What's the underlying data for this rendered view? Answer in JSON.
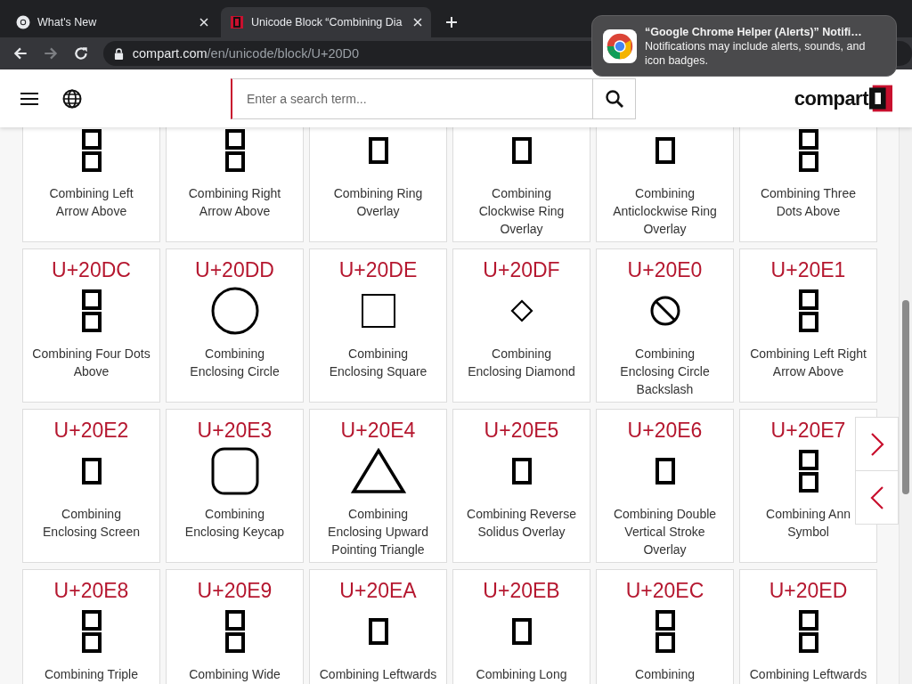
{
  "browser": {
    "tabs": [
      {
        "title": "What's New",
        "selected": false,
        "kind": "chrome"
      },
      {
        "title": "Unicode Block “Combining Dia",
        "selected": true,
        "kind": "site"
      }
    ],
    "url_host": "compart.com",
    "url_path": "/en/unicode/block/U+20D0"
  },
  "notification": {
    "title": "“Google Chrome Helper (Alerts)” Notifi…",
    "body": "Notifications may include alerts, sounds, and icon badges."
  },
  "site_header": {
    "search": {
      "placeholder": "Enter a search term..."
    },
    "logo": "compart"
  },
  "characters": [
    {
      "kind": "tofu-double",
      "name": "Combining Left\nArrow Above"
    },
    {
      "kind": "tofu-double",
      "name": "Combining Right\nArrow Above"
    },
    {
      "kind": "tofu",
      "name": "Combining Ring\nOverlay"
    },
    {
      "kind": "tofu",
      "name": "Combining\nClockwise Ring\nOverlay"
    },
    {
      "kind": "tofu",
      "name": "Combining\nAnticlockwise Ring\nOverlay"
    },
    {
      "kind": "tofu-double",
      "name": "Combining Three\nDots Above"
    },
    {
      "code": "U+20DC",
      "kind": "tofu-double",
      "name": "Combining Four Dots\nAbove"
    },
    {
      "code": "U+20DD",
      "kind": "circle",
      "name": "Combining\nEnclosing Circle"
    },
    {
      "code": "U+20DE",
      "kind": "square",
      "name": "Combining\nEnclosing Square"
    },
    {
      "code": "U+20DF",
      "kind": "diamond",
      "name": "Combining\nEnclosing Diamond"
    },
    {
      "code": "U+20E0",
      "kind": "circle-slash",
      "name": "Combining\nEnclosing Circle\nBackslash"
    },
    {
      "code": "U+20E1",
      "kind": "tofu-double",
      "name": "Combining Left Right\nArrow Above"
    },
    {
      "code": "U+20E2",
      "kind": "tofu",
      "name": "Combining\nEnclosing Screen"
    },
    {
      "code": "U+20E3",
      "kind": "keycap",
      "name": "Combining\nEnclosing Keycap"
    },
    {
      "code": "U+20E4",
      "kind": "triangle",
      "name": "Combining\nEnclosing Upward\nPointing Triangle"
    },
    {
      "code": "U+20E5",
      "kind": "tofu",
      "name": "Combining Reverse\nSolidus Overlay"
    },
    {
      "code": "U+20E6",
      "kind": "tofu",
      "name": "Combining Double\nVertical Stroke\nOverlay"
    },
    {
      "code": "U+20E7",
      "kind": "tofu-double",
      "name": "Combining Ann\nSymbol"
    },
    {
      "code": "U+20E8",
      "kind": "tofu-double",
      "name": "Combining Triple"
    },
    {
      "code": "U+20E9",
      "kind": "tofu-double",
      "name": "Combining Wide"
    },
    {
      "code": "U+20EA",
      "kind": "tofu",
      "name": "Combining Leftwards"
    },
    {
      "code": "U+20EB",
      "kind": "tofu",
      "name": "Combining Long"
    },
    {
      "code": "U+20EC",
      "kind": "tofu-double",
      "name": "Combining"
    },
    {
      "code": "U+20ED",
      "kind": "tofu-double",
      "name": "Combining Leftwards"
    }
  ]
}
